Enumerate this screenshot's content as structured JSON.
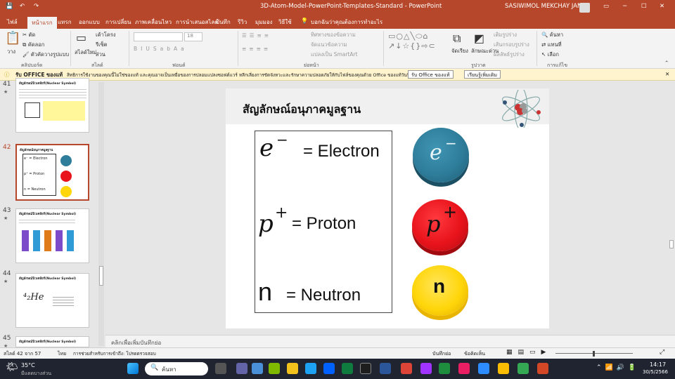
{
  "titlebar": {
    "doc_title": "3D-Atom-Model-PowerPoint-Templates-Standard  -  PowerPoint",
    "user": "SASIWIMOL  MEKCHAY JANNY"
  },
  "tabs": [
    "ไฟล์",
    "หน้าแรก",
    "แทรก",
    "ออกแบบ",
    "การเปลี่ยน",
    "ภาพเคลื่อนไหว",
    "การนำเสนอสไลด์",
    "บันทึก",
    "รีวิว",
    "มุมมอง",
    "วิธีใช้"
  ],
  "tell_me": "บอกฉันว่าคุณต้องการทำอะไร",
  "ribbon": {
    "clipboard": {
      "paste": "วาง",
      "cut": "ตัด",
      "copy": "คัดลอก",
      "format_painter": "ตัวคัดวางรูปแบบ",
      "label": "คลิปบอร์ด"
    },
    "slides": {
      "new_slide": "สไลด์ใหม่",
      "layout": "เค้าโครง",
      "reset": "รีเซ็ต",
      "section": "ส่วน",
      "label": "สไลด์"
    },
    "font": {
      "size": "18",
      "label": "ฟอนต์"
    },
    "paragraph": {
      "direction": "ทิศทางของข้อความ",
      "align": "จัดแนวข้อความ",
      "smartart": "แปลงเป็น SmartArt",
      "label": "ย่อหน้า"
    },
    "drawing": {
      "arrange": "จัดเรียง",
      "quick_styles": "ลักษณะด่วน",
      "fill": "เติมรูปร่าง",
      "outline": "เส้นกรอบรูปร่าง",
      "effects": "ผลลัพธ์รูปร่าง",
      "label": "รูปวาด"
    },
    "editing": {
      "find": "ค้นหา",
      "replace": "แทนที่",
      "select": "เลือก",
      "label": "การแก้ไข"
    }
  },
  "message_bar": {
    "title": "รับ OFFICE ของแท้",
    "text": "สิทธิการใช้งานของคุณนี้ไม่ใช่ของแท้ และคุณอาจเป็นเหยื่อของการปลอมแปลงซอฟต์แวร์ หลีกเลี่ยงการขัดจังหวะและรักษาความปลอดภัยให้กับไฟล์ของคุณด้วย Office ของแท้วันนี้",
    "btn_genuine": "รับ Office ของแท้",
    "btn_learn": "เรียนรู้เพิ่มเติม"
  },
  "thumbnails": [
    {
      "num": "41",
      "title": "สัญลักษณ์นิวเคลียร์(Nuclear Symbol)"
    },
    {
      "num": "42",
      "title": "สัญลักษณ์อนุภาคมูลฐาน"
    },
    {
      "num": "43",
      "title": "สัญลักษณ์นิวเคลียร์(Nuclear Symbol)"
    },
    {
      "num": "44",
      "title": "สัญลักษณ์นิวเคลียร์(Nuclear Symbol)"
    },
    {
      "num": "45",
      "title": "สัญลักษณ์นิวเคลียร์(Nuclear Symbol)"
    }
  ],
  "slide": {
    "title": "สัญลักษณ์อนุภาคมูลฐาน",
    "rows": [
      {
        "symbol": "e",
        "sup": "−",
        "label": "=  Electron"
      },
      {
        "symbol": "p",
        "sup": "+",
        "label": "= Proton"
      },
      {
        "symbol": "n",
        "sup": "",
        "label": "=  Neutron"
      }
    ],
    "balls": [
      {
        "text": "e",
        "sup": "−",
        "color": "#2e7d9a"
      },
      {
        "text": "p",
        "sup": "+",
        "color": "#e8131b"
      },
      {
        "text": "n",
        "sup": "",
        "color": "#ffd60a"
      }
    ]
  },
  "notes_placeholder": "คลิกเพื่อเพิ่มบันทึกย่อ",
  "status": {
    "slide_counter": "สไลด์ 42 จาก 57",
    "language": "ไทย",
    "accessibility": "การช่วยสำหรับการเข้าถึง: โปรดตรวจสอบ",
    "notes": "บันทึกย่อ",
    "comments": "ข้อคิดเห็น"
  },
  "taskbar": {
    "temperature": "35°C",
    "weather": "มีแดดบางส่วน",
    "search": "ค้นหา",
    "time": "14:17",
    "date": "30/5/2566",
    "lang": "TH"
  }
}
